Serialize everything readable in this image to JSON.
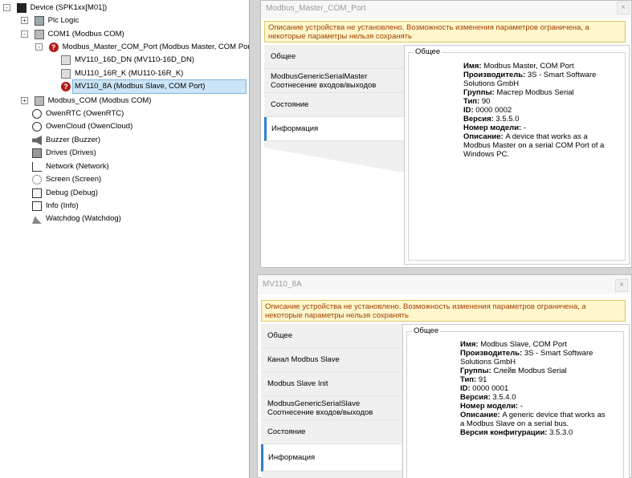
{
  "tree": {
    "items": [
      {
        "label": "Device (SPK1xx[M01])",
        "icon": "device-icon",
        "expander": "-"
      },
      {
        "label": "Plc Logic",
        "icon": "plc-logic-icon",
        "expander": "+"
      },
      {
        "label": "COM1 (Modbus COM)",
        "icon": "com-port-icon",
        "expander": "-"
      },
      {
        "label": "Modbus_Master_COM_Port (Modbus Master, COM Port)",
        "icon": "error-icon",
        "expander": "-"
      },
      {
        "label": "MV110_16D_DN (MV110-16D_DN)",
        "icon": "module-icon",
        "expander": ""
      },
      {
        "label": "MU110_16R_K (MU110-16R_K)",
        "icon": "module-icon",
        "expander": ""
      },
      {
        "label": "MV110_8A (Modbus Slave, COM Port)",
        "icon": "error-icon",
        "expander": ""
      },
      {
        "label": "Modbus_COM (Modbus COM)",
        "icon": "com-port-icon",
        "expander": "+"
      },
      {
        "label": "OwenRTC (OwenRTC)",
        "icon": "clock-icon",
        "expander": ""
      },
      {
        "label": "OwenCloud (OwenCloud)",
        "icon": "cloud-icon",
        "expander": ""
      },
      {
        "label": "Buzzer (Buzzer)",
        "icon": "speaker-icon",
        "expander": ""
      },
      {
        "label": "Drives (Drives)",
        "icon": "drives-icon",
        "expander": ""
      },
      {
        "label": "Network (Network)",
        "icon": "network-icon",
        "expander": ""
      },
      {
        "label": "Screen (Screen)",
        "icon": "screen-icon",
        "expander": ""
      },
      {
        "label": "Debug (Debug)",
        "icon": "debug-icon",
        "expander": ""
      },
      {
        "label": "Info (Info)",
        "icon": "info-icon",
        "expander": ""
      },
      {
        "label": "Watchdog (Watchdog)",
        "icon": "watchdog-icon",
        "expander": ""
      }
    ]
  },
  "master": {
    "title": "Modbus_Master_COM_Port",
    "close": "×",
    "warning_line1": "Описание устройства не установлено. Возможность изменения параметров ограничена, а",
    "warning_line2": "некоторые параметры нельзя сохранять",
    "tabs": [
      {
        "line1": "Общее",
        "line2": ""
      },
      {
        "line1": "ModbusGenericSerialMaster",
        "line2": "Соотнесение входов/выходов"
      },
      {
        "line1": "Состояние",
        "line2": ""
      },
      {
        "line1": "Информация",
        "line2": ""
      }
    ],
    "group_title": "Общее",
    "info": [
      {
        "key": "Имя:",
        "value": " Modbus Master, COM Port"
      },
      {
        "key": "Производитель:",
        "value": " 3S - Smart Software"
      },
      {
        "key": "",
        "value": "Solutions GmbH"
      },
      {
        "key": "Группы:",
        "value": " Мастер Modbus Serial"
      },
      {
        "key": "Тип:",
        "value": " 90"
      },
      {
        "key": "ID:",
        "value": " 0000 0002"
      },
      {
        "key": "Версия:",
        "value": " 3.5.5.0"
      },
      {
        "key": "Номер модели:",
        "value": " -"
      },
      {
        "key": "Описание:",
        "value": " A device that works as a"
      },
      {
        "key": "",
        "value": "Modbus Master on a serial COM Port of a"
      },
      {
        "key": "",
        "value": "Windows PC."
      }
    ]
  },
  "slave": {
    "title": "MV110_8A",
    "close": "×",
    "warning_line1": "Описание устройства не установлено. Возможность изменения параметров ограничена, а",
    "warning_line2": "некоторые параметры нельзя сохранять",
    "tabs": [
      {
        "line1": "Общее",
        "line2": ""
      },
      {
        "line1": "Канал Modbus Slave",
        "line2": ""
      },
      {
        "line1": "Modbus Slave Init",
        "line2": ""
      },
      {
        "line1": "ModbusGenericSerialSlave",
        "line2": "Соотнесение входов/выходов"
      },
      {
        "line1": "Состояние",
        "line2": ""
      },
      {
        "line1": "Информация",
        "line2": ""
      }
    ],
    "group_title": "Общее",
    "info": [
      {
        "key": "Имя:",
        "value": " Modbus Slave, COM Port"
      },
      {
        "key": "Производитель:",
        "value": " 3S - Smart Software"
      },
      {
        "key": "",
        "value": "Solutions GmbH"
      },
      {
        "key": "Группы:",
        "value": " Слейв Modbus Serial"
      },
      {
        "key": "Тип:",
        "value": " 91"
      },
      {
        "key": "ID:",
        "value": " 0000 0001"
      },
      {
        "key": "Версия:",
        "value": " 3.5.4.0"
      },
      {
        "key": "Номер модели:",
        "value": " -"
      },
      {
        "key": "Описание:",
        "value": " A generic device that works as"
      },
      {
        "key": "",
        "value": "a Modbus Slave on a serial bus."
      },
      {
        "key": "Версия конфигурации:",
        "value": " 3.5.3.0"
      }
    ]
  }
}
